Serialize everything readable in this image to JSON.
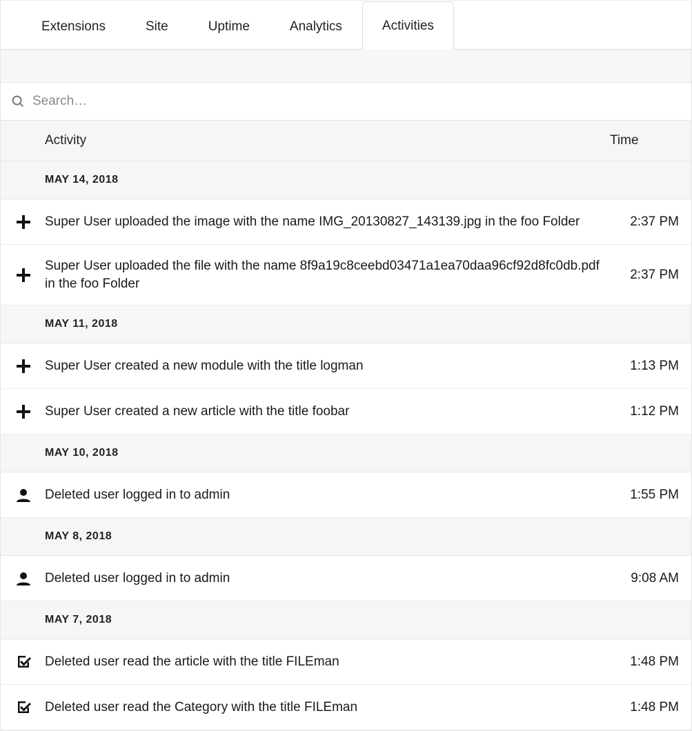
{
  "tabs": [
    {
      "label": "Extensions",
      "active": false
    },
    {
      "label": "Site",
      "active": false
    },
    {
      "label": "Uptime",
      "active": false
    },
    {
      "label": "Analytics",
      "active": false
    },
    {
      "label": "Activities",
      "active": true
    }
  ],
  "search": {
    "placeholder": "Search…"
  },
  "columns": {
    "activity": "Activity",
    "time": "Time"
  },
  "groups": [
    {
      "date": "MAY 14, 2018",
      "items": [
        {
          "icon": "plus",
          "text": "Super User uploaded the image with the name IMG_20130827_143139.jpg in the foo Folder",
          "time": "2:37 PM"
        },
        {
          "icon": "plus",
          "text": "Super User uploaded the file with the name 8f9a19c8ceebd03471a1ea70daa96cf92d8fc0db.pdf in the foo Folder",
          "time": "2:37 PM"
        }
      ]
    },
    {
      "date": "MAY 11, 2018",
      "items": [
        {
          "icon": "plus",
          "text": "Super User created a new module with the title logman",
          "time": "1:13 PM"
        },
        {
          "icon": "plus",
          "text": "Super User created a new article with the title foobar",
          "time": "1:12 PM"
        }
      ]
    },
    {
      "date": "MAY 10, 2018",
      "items": [
        {
          "icon": "user",
          "text": "Deleted user logged in to admin",
          "time": "1:55 PM"
        }
      ]
    },
    {
      "date": "MAY 8, 2018",
      "items": [
        {
          "icon": "user",
          "text": "Deleted user logged in to admin",
          "time": "9:08 AM"
        }
      ]
    },
    {
      "date": "MAY 7, 2018",
      "items": [
        {
          "icon": "check",
          "text": "Deleted user read the article with the title FILEman",
          "time": "1:48 PM"
        },
        {
          "icon": "check",
          "text": "Deleted user read the Category with the title FILEman",
          "time": "1:48 PM"
        }
      ]
    }
  ]
}
